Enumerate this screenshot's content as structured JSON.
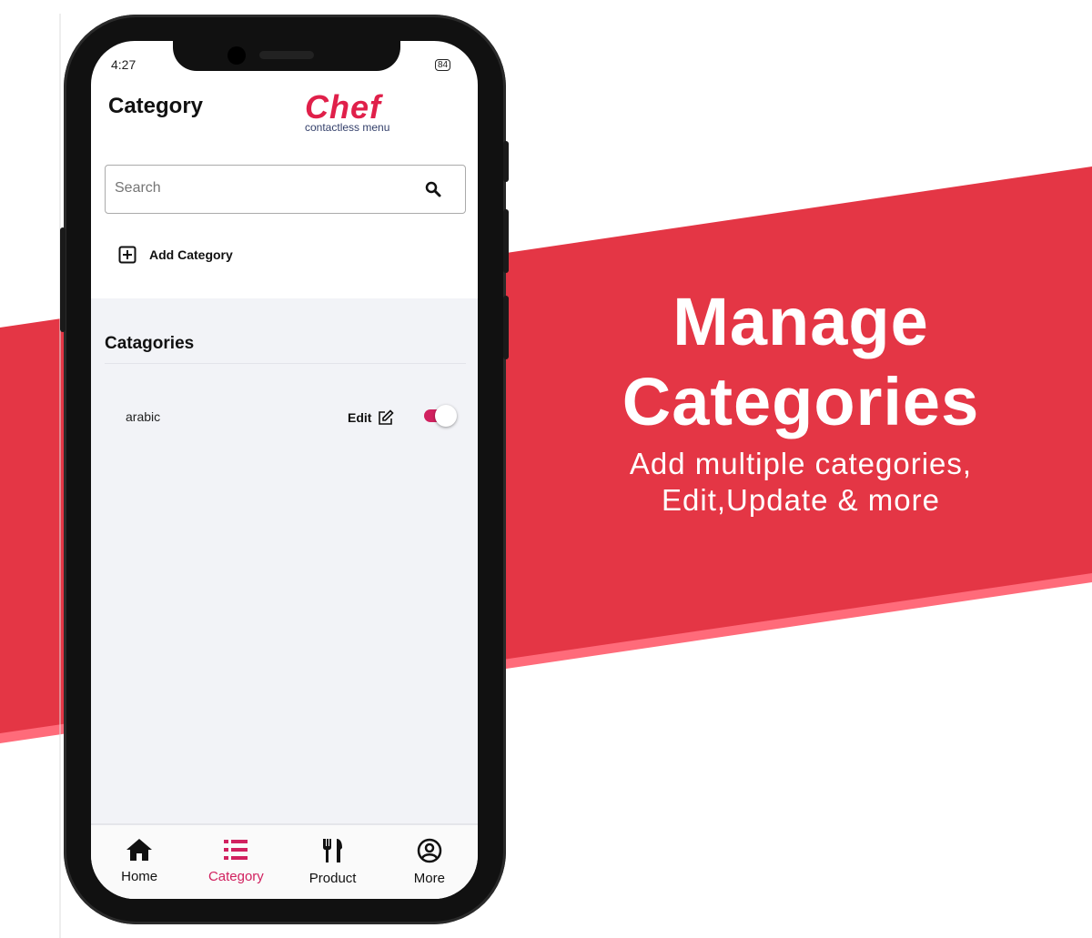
{
  "colors": {
    "banner_red": "#e43645",
    "banner_stripe": "#ff6b7a",
    "accent": "#d1215f"
  },
  "status_bar": {
    "time": "4:27",
    "battery": "84"
  },
  "header": {
    "title": "Category",
    "logo_text": "Chef",
    "logo_subtitle": "contactless menu"
  },
  "search": {
    "placeholder": "Search",
    "icon": "search-icon"
  },
  "add_category": {
    "label": "Add Category",
    "icon": "plus-square-icon"
  },
  "section": {
    "title": "Catagories"
  },
  "categories": [
    {
      "name": "arabic",
      "edit_label": "Edit",
      "enabled": true
    }
  ],
  "bottom_nav": [
    {
      "label": "Home",
      "icon": "home-icon",
      "active": false
    },
    {
      "label": "Category",
      "icon": "list-icon",
      "active": true
    },
    {
      "label": "Product",
      "icon": "utensils-icon",
      "active": false
    },
    {
      "label": "More",
      "icon": "user-circle-icon",
      "active": false
    }
  ],
  "promo": {
    "headline_line1": "Manage",
    "headline_line2": "Categories",
    "sub_line1": "Add multiple categories,",
    "sub_line2": "Edit,Update & more"
  }
}
